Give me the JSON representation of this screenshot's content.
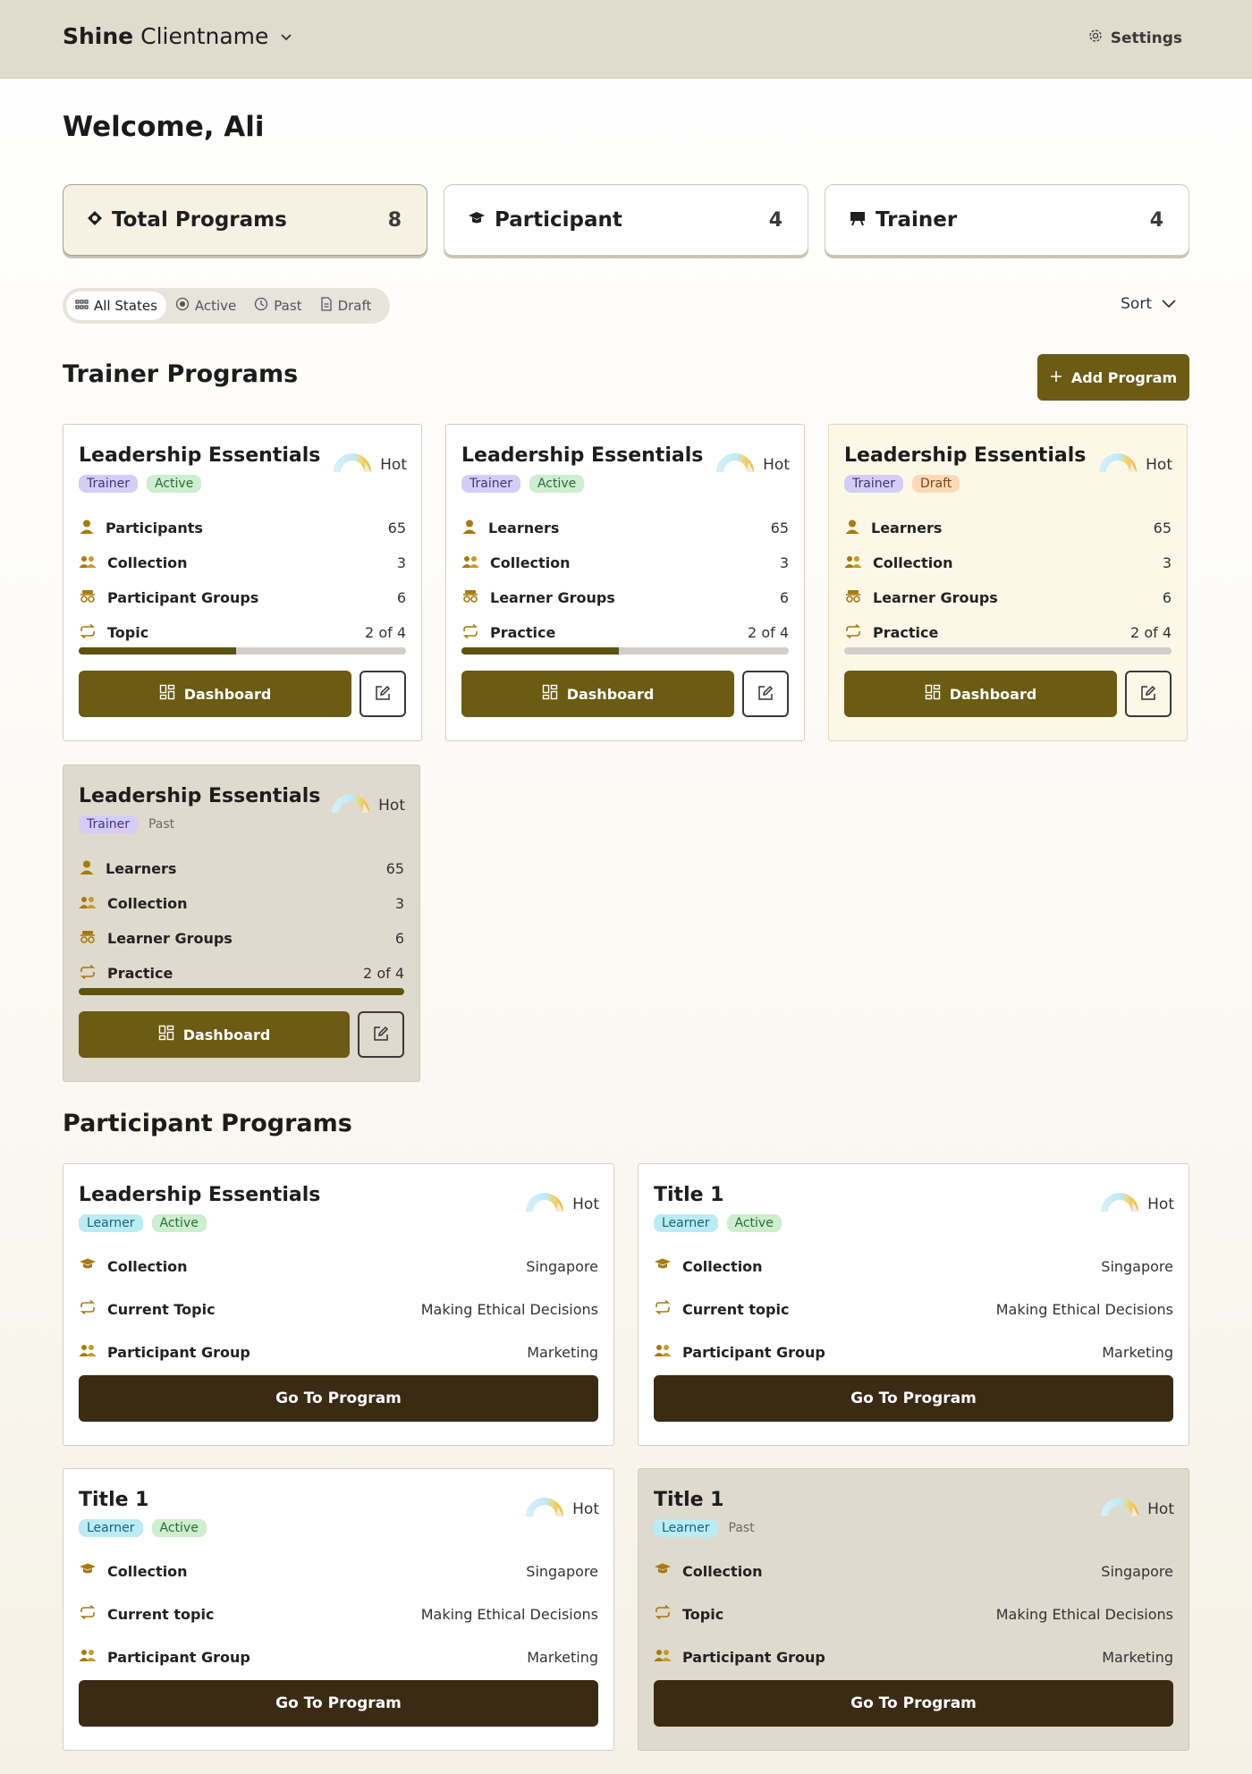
{
  "header": {
    "brand_bold": "Shine",
    "brand_rest": "Clientname",
    "brand_dropdown_icon": "chevron-down-icon",
    "settings_label": "Settings",
    "settings_icon": "gear-icon"
  },
  "welcome": "Welcome, Ali",
  "stats": [
    {
      "label": "Total Programs",
      "count": "8",
      "icon": "target-icon",
      "selected": true
    },
    {
      "label": "Participant",
      "count": "4",
      "icon": "graduation-cap-icon",
      "selected": false
    },
    {
      "label": "Trainer",
      "count": "4",
      "icon": "presentation-board-icon",
      "selected": false
    }
  ],
  "filters": [
    {
      "label": "All States",
      "icon": "grid-icon",
      "selected": true
    },
    {
      "label": "Active",
      "icon": "radio-icon",
      "selected": false
    },
    {
      "label": "Past",
      "icon": "clock-icon",
      "selected": false
    },
    {
      "label": "Draft",
      "icon": "document-icon",
      "selected": false
    }
  ],
  "sort_label": "Sort",
  "trainer_section": {
    "title": "Trainer Programs",
    "add_button": "Add Program"
  },
  "trainer_cards": [
    {
      "title": "Leadership Essentials",
      "hot": "Hot",
      "chips": [
        {
          "text": "Trainer",
          "kind": "trainer"
        },
        {
          "text": "Active",
          "kind": "active"
        }
      ],
      "rows": [
        {
          "label": "Participants",
          "value": "65",
          "icon": "person-icon"
        },
        {
          "label": "Collection",
          "value": "3",
          "icon": "people-icon"
        },
        {
          "label": "Participant Groups",
          "value": "6",
          "icon": "group-icon"
        },
        {
          "label": "Topic",
          "value": "2 of 4",
          "icon": "repeat-icon"
        }
      ],
      "progress": 0.48,
      "dashboard": "Dashboard",
      "state": "active"
    },
    {
      "title": "Leadership Essentials",
      "hot": "Hot",
      "chips": [
        {
          "text": "Trainer",
          "kind": "trainer"
        },
        {
          "text": "Active",
          "kind": "active"
        }
      ],
      "rows": [
        {
          "label": "Learners",
          "value": "65",
          "icon": "person-icon"
        },
        {
          "label": "Collection",
          "value": "3",
          "icon": "people-icon"
        },
        {
          "label": "Learner Groups",
          "value": "6",
          "icon": "group-icon"
        },
        {
          "label": "Practice",
          "value": "2 of 4",
          "icon": "repeat-icon"
        }
      ],
      "progress": 0.48,
      "dashboard": "Dashboard",
      "state": "active"
    },
    {
      "title": "Leadership Essentials",
      "hot": "Hot",
      "chips": [
        {
          "text": "Trainer",
          "kind": "trainer"
        },
        {
          "text": "Draft",
          "kind": "draft"
        }
      ],
      "rows": [
        {
          "label": "Learners",
          "value": "65",
          "icon": "person-icon"
        },
        {
          "label": "Collection",
          "value": "3",
          "icon": "people-icon"
        },
        {
          "label": "Learner Groups",
          "value": "6",
          "icon": "group-icon"
        },
        {
          "label": "Practice",
          "value": "2 of 4",
          "icon": "repeat-icon"
        }
      ],
      "progress": 0,
      "dashboard": "Dashboard",
      "state": "draft"
    },
    {
      "title": "Leadership Essentials",
      "hot": "Hot",
      "chips": [
        {
          "text": "Trainer",
          "kind": "trainer"
        },
        {
          "text": "Past",
          "kind": "past"
        }
      ],
      "rows": [
        {
          "label": "Learners",
          "value": "65",
          "icon": "person-icon"
        },
        {
          "label": "Collection",
          "value": "3",
          "icon": "people-icon"
        },
        {
          "label": "Learner Groups",
          "value": "6",
          "icon": "group-icon"
        },
        {
          "label": "Practice",
          "value": "2 of 4",
          "icon": "repeat-icon"
        }
      ],
      "progress": 1,
      "dashboard": "Dashboard",
      "state": "past"
    }
  ],
  "participant_section": {
    "title": "Participant Programs"
  },
  "participant_cards": [
    {
      "title": "Leadership Essentials",
      "hot": "Hot",
      "chips": [
        {
          "text": "Learner",
          "kind": "learner"
        },
        {
          "text": "Active",
          "kind": "active"
        }
      ],
      "rows": [
        {
          "label": "Collection",
          "value": "Singapore",
          "icon": "graduation-cap-icon"
        },
        {
          "label": "Current Topic",
          "value": "Making Ethical Decisions",
          "icon": "repeat-icon"
        },
        {
          "label": "Participant Group",
          "value": "Marketing",
          "icon": "people-icon"
        }
      ],
      "button": "Go To Program",
      "state": "active"
    },
    {
      "title": "Title 1",
      "hot": "Hot",
      "chips": [
        {
          "text": "Learner",
          "kind": "learner"
        },
        {
          "text": "Active",
          "kind": "active"
        }
      ],
      "rows": [
        {
          "label": "Collection",
          "value": "Singapore",
          "icon": "graduation-cap-icon"
        },
        {
          "label": "Current topic",
          "value": "Making Ethical Decisions",
          "icon": "repeat-icon"
        },
        {
          "label": "Participant Group",
          "value": "Marketing",
          "icon": "people-icon"
        }
      ],
      "button": "Go To Program",
      "state": "active"
    },
    {
      "title": "Title 1",
      "hot": "Hot",
      "chips": [
        {
          "text": "Learner",
          "kind": "learner"
        },
        {
          "text": "Active",
          "kind": "active"
        }
      ],
      "rows": [
        {
          "label": "Collection",
          "value": "Singapore",
          "icon": "graduation-cap-icon"
        },
        {
          "label": "Current topic",
          "value": "Making Ethical Decisions",
          "icon": "repeat-icon"
        },
        {
          "label": "Participant Group",
          "value": "Marketing",
          "icon": "people-icon"
        }
      ],
      "button": "Go To Program",
      "state": "active"
    },
    {
      "title": "Title 1",
      "hot": "Hot",
      "chips": [
        {
          "text": "Learner",
          "kind": "learner"
        },
        {
          "text": "Past",
          "kind": "past"
        }
      ],
      "rows": [
        {
          "label": "Collection",
          "value": "Singapore",
          "icon": "graduation-cap-icon"
        },
        {
          "label": "Topic",
          "value": "Making Ethical Decisions",
          "icon": "repeat-icon"
        },
        {
          "label": "Participant Group",
          "value": "Marketing",
          "icon": "people-icon"
        }
      ],
      "button": "Go To Program",
      "state": "past"
    }
  ],
  "colors": {
    "olive": "#6b5b13",
    "brown": "#3b2a14",
    "header_bg": "#e0dbcd",
    "icon_gold": "#a8790c"
  }
}
